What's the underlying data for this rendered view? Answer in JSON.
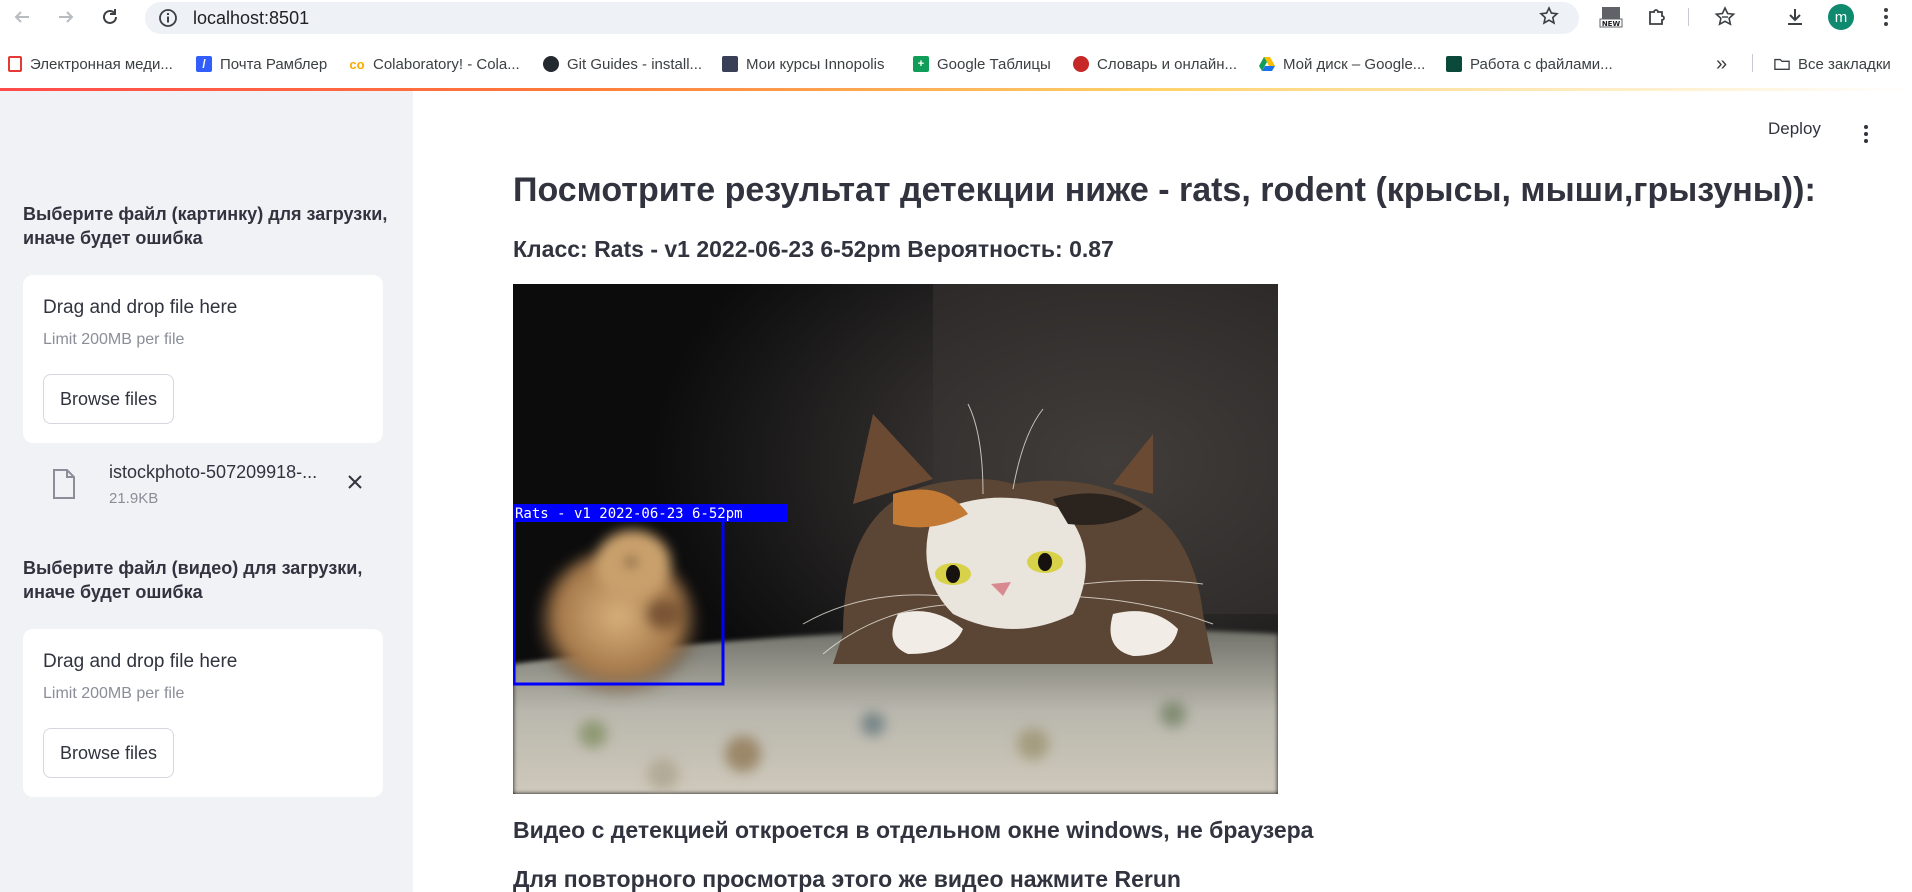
{
  "browser": {
    "url": "localhost:8501",
    "profile_initial": "m",
    "bookmarks": [
      {
        "label": "Электронная меди...",
        "icon": "medical-bookmark-icon",
        "color": "#e53935"
      },
      {
        "label": "Почта Рамблер",
        "icon": "rambler-icon",
        "color": "#315efb"
      },
      {
        "label": "Colaboratory! - Cola...",
        "icon": "colab-icon",
        "color": "#f9ab00"
      },
      {
        "label": "Git Guides - install...",
        "icon": "github-icon",
        "color": "#24292f"
      },
      {
        "label": "Мои курсы Innopolis",
        "icon": "innopolis-icon",
        "color": "#3a3f58"
      },
      {
        "label": "Google Таблицы",
        "icon": "sheets-icon",
        "color": "#0f9d58"
      },
      {
        "label": "Словарь и онлайн...",
        "icon": "dictionary-icon",
        "color": "#c62828"
      },
      {
        "label": "Мой диск – Google...",
        "icon": "drive-icon",
        "color": "#1a73e8"
      },
      {
        "label": "Работа с файлами...",
        "icon": "file-work-icon",
        "color": "#0b4a3a"
      }
    ],
    "all_bookmarks_label": "Все закладки"
  },
  "sidebar": {
    "image_uploader": {
      "label": "Выберите файл (картинку) для загрузки, иначе будет ошибка",
      "drop_text": "Drag and drop file here",
      "limit_text": "Limit 200MB per file",
      "browse_label": "Browse files",
      "uploaded_file": {
        "name": "istockphoto-507209918-...",
        "size": "21.9KB"
      }
    },
    "video_uploader": {
      "label": "Выберите файл (видео) для загрузки, иначе будет ошибка",
      "drop_text": "Drag and drop file here",
      "limit_text": "Limit 200MB per file",
      "browse_label": "Browse files"
    }
  },
  "header": {
    "deploy_label": "Deploy"
  },
  "main": {
    "title": "Посмотрите результат детекции ниже - rats, rodent (крысы, мыши,грызуны)):",
    "class_line": "Класс: Rats - v1 2022-06-23 6-52pm Вероятность: 0.87",
    "detection_label": "Rats - v1 2022-06-23 6-52pm",
    "note_video": "Видео с детекцией откроется в отдельном окне windows, не браузера",
    "note_rerun": "Для повторного просмотра этого же видео нажмите Rerun"
  },
  "colors": {
    "accent": "#ff4b4b",
    "sidebar_bg": "#f0f2f6",
    "text": "#31333f",
    "bbox": "#0000ff"
  }
}
